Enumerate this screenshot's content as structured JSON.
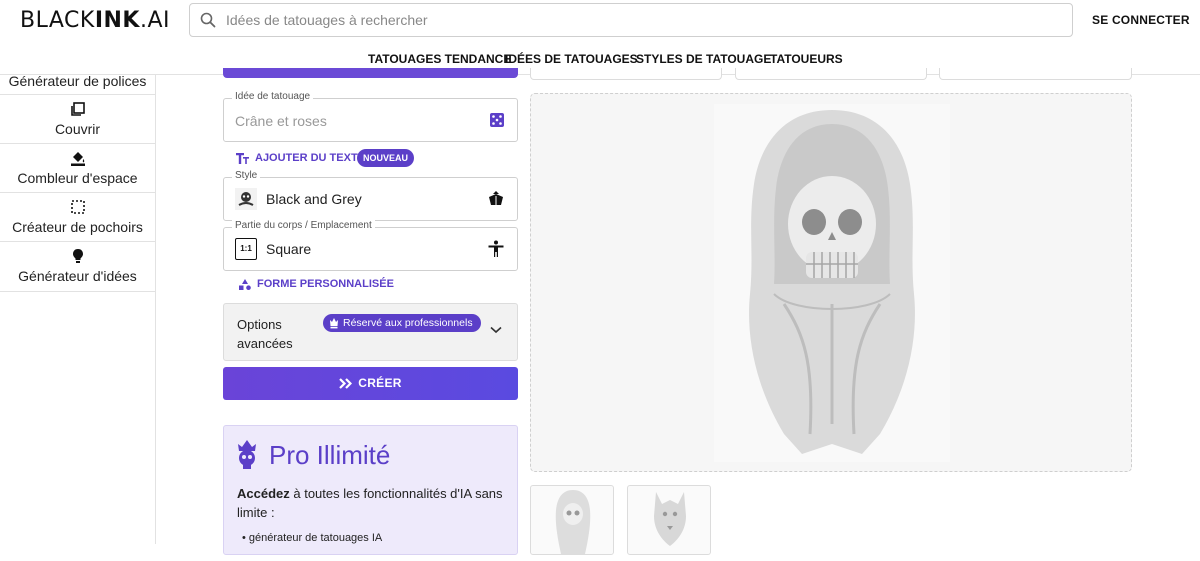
{
  "header": {
    "logo": {
      "part1": "BLACK",
      "part2": "INK",
      "part3": ".AI"
    },
    "search_placeholder": "Idées de tatouages à rechercher",
    "login_label": "SE CONNECTER"
  },
  "nav": {
    "items": [
      {
        "label": "TATOUAGES TENDANCE"
      },
      {
        "label": "IDÉES DE TATOUAGES"
      },
      {
        "label": "STYLES DE TATOUAGE"
      },
      {
        "label": "TATOUEURS"
      }
    ]
  },
  "sidebar": {
    "items": [
      {
        "label": "Générateur de polices",
        "icon": "font-icon"
      },
      {
        "label": "Couvrir",
        "icon": "cover-icon"
      },
      {
        "label": "Combleur d'espace",
        "icon": "paint-bucket-icon"
      },
      {
        "label": "Créateur de pochoirs",
        "icon": "stencil-icon"
      },
      {
        "label": "Générateur d'idées",
        "icon": "lightbulb-icon"
      }
    ]
  },
  "form": {
    "idea": {
      "legend": "Idée de tatouage",
      "placeholder": "Crâne et roses"
    },
    "add_text": {
      "label": "AJOUTER DU TEXTE",
      "badge": "NOUVEAU"
    },
    "style": {
      "legend": "Style",
      "value": "Black and Grey"
    },
    "placement": {
      "legend": "Partie du corps / Emplacement",
      "value": "Square",
      "ratio_icon_text": "1:1"
    },
    "custom_shape": {
      "label": "FORME PERSONNALISÉE"
    },
    "advanced": {
      "label": "Options avancées",
      "pro_badge": "Réservé aux professionnels"
    },
    "create_label": "CRÉER"
  },
  "promo": {
    "title": "Pro Illimité",
    "body_bold": "Accédez",
    "body_rest": " à toutes les fonctionnalités d'IA sans limite :",
    "bullets": [
      "générateur de tatouages IA"
    ]
  },
  "colors": {
    "accent": "#5b3fc8",
    "button_gradient_start": "#6a44d8",
    "promo_bg": "#eeeafb"
  },
  "preview": {
    "main_image": "hooded-skull-tattoo",
    "thumbnails": [
      "hooded-skull-thumbnail",
      "wolf-thumbnail"
    ]
  }
}
